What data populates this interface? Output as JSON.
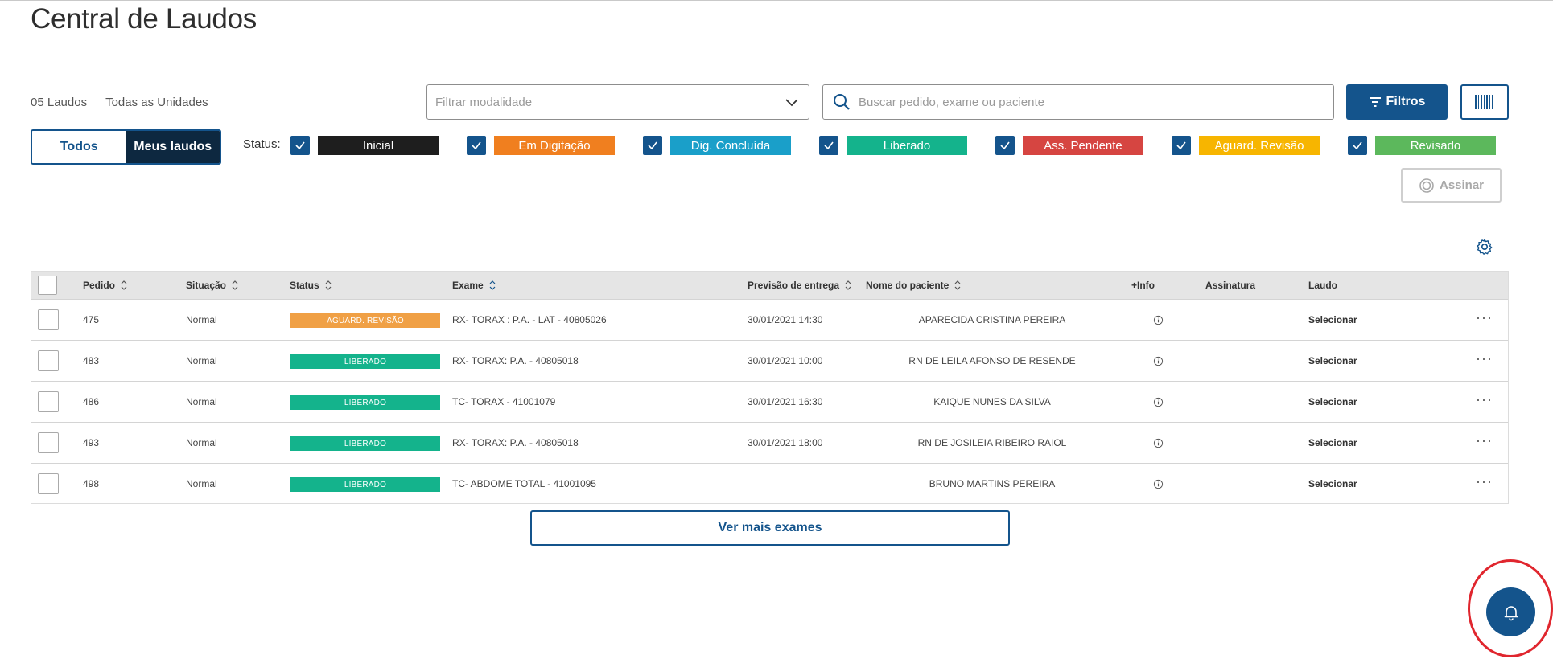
{
  "header": {
    "title": "Central de Laudos"
  },
  "summary": {
    "count": "05 Laudos",
    "units": "Todas as Unidades"
  },
  "filters": {
    "modality_placeholder": "Filtrar modalidade",
    "search_placeholder": "Buscar pedido, exame ou paciente",
    "filters_button": "Filtros"
  },
  "toggle": {
    "all": "Todos",
    "mine": "Meus laudos",
    "selected": "Meus laudos"
  },
  "status_label": "Status:",
  "status_filters": [
    {
      "label": "Inicial",
      "color": "#1e1e1e",
      "checked": true
    },
    {
      "label": "Em Digitação",
      "color": "#f07f1f",
      "checked": true
    },
    {
      "label": "Dig. Concluída",
      "color": "#1a9fc9",
      "checked": true
    },
    {
      "label": "Liberado",
      "color": "#14b38c",
      "checked": true
    },
    {
      "label": "Ass. Pendente",
      "color": "#d64541",
      "checked": true
    },
    {
      "label": "Aguard. Revisão",
      "color": "#f7b500",
      "checked": true
    },
    {
      "label": "Revisado",
      "color": "#5cb85c",
      "checked": true
    }
  ],
  "sign_button": "Assinar",
  "table": {
    "columns": {
      "pedido": "Pedido",
      "situacao": "Situação",
      "status": "Status",
      "exame": "Exame",
      "previsao": "Previsão de entrega",
      "paciente": "Nome do paciente",
      "info": "+Info",
      "assinatura": "Assinatura",
      "laudo": "Laudo"
    },
    "rows": [
      {
        "pedido": "475",
        "situacao": "Normal",
        "status": "AGUARD. REVISÃO",
        "status_color": "#f0a045",
        "exame": "RX- TORAX : P.A. - LAT - 40805026",
        "previsao": "30/01/2021 14:30",
        "paciente": "APARECIDA CRISTINA PEREIRA",
        "laudo": "Selecionar"
      },
      {
        "pedido": "483",
        "situacao": "Normal",
        "status": "LIBERADO",
        "status_color": "#14b38c",
        "exame": "RX- TORAX: P.A. - 40805018",
        "previsao": "30/01/2021 10:00",
        "paciente": "RN DE LEILA AFONSO DE RESENDE",
        "laudo": "Selecionar"
      },
      {
        "pedido": "486",
        "situacao": "Normal",
        "status": "LIBERADO",
        "status_color": "#14b38c",
        "exame": "TC- TORAX - 41001079",
        "previsao": "30/01/2021 16:30",
        "paciente": "KAIQUE NUNES DA SILVA",
        "laudo": "Selecionar"
      },
      {
        "pedido": "493",
        "situacao": "Normal",
        "status": "LIBERADO",
        "status_color": "#14b38c",
        "exame": "RX- TORAX: P.A. - 40805018",
        "previsao": "30/01/2021 18:00",
        "paciente": "RN DE JOSILEIA RIBEIRO RAIOL",
        "laudo": "Selecionar"
      },
      {
        "pedido": "498",
        "situacao": "Normal",
        "status": "LIBERADO",
        "status_color": "#14b38c",
        "exame": "TC- ABDOME TOTAL - 41001095",
        "previsao": "",
        "paciente": "BRUNO MARTINS PEREIRA",
        "laudo": "Selecionar"
      }
    ]
  },
  "load_more": "Ver mais exames",
  "icons": {
    "notification": "bell-icon",
    "settings": "gear-icon",
    "search": "search-icon",
    "barcode": "barcode-icon"
  },
  "colors": {
    "primary": "#14548c",
    "highlight_ring": "#e0262e"
  }
}
